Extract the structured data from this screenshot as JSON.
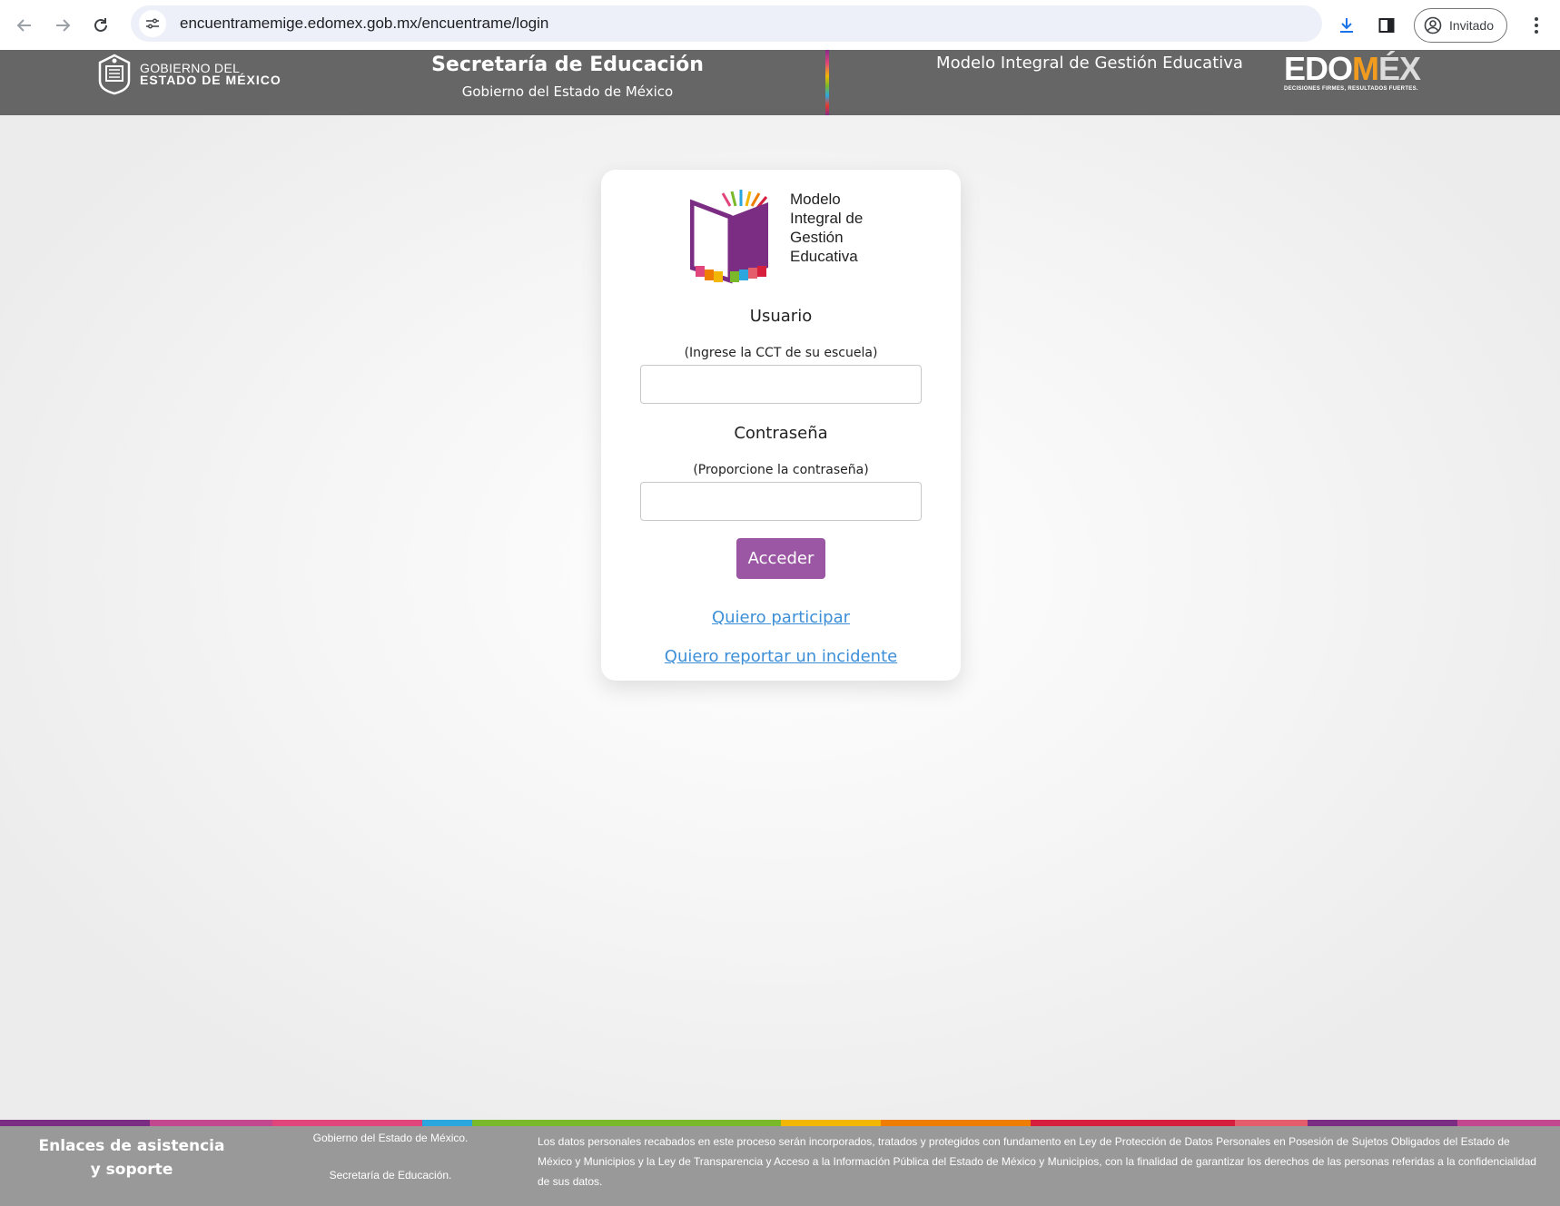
{
  "browser": {
    "url": "encuentramemige.edomex.gob.mx/encuentrame/login",
    "profile_label": "Invitado"
  },
  "header": {
    "gob_logo_line1": "GOBIERNO DEL",
    "gob_logo_line2": "ESTADO DE MÉXICO",
    "title": "Secretaría de Educación",
    "subtitle": "Gobierno del Estado de México",
    "program_title": "Modelo Integral de Gestión Educativa",
    "edomex_logo": {
      "word_edo": "EDO",
      "word_m": "M",
      "word_ex": "ÉX",
      "tagline": "DECISIONES FIRMES, RESULTADOS FUERTES."
    }
  },
  "login": {
    "logo_text": [
      "Modelo",
      "Integral de",
      "Gestión",
      "Educativa"
    ],
    "usuario_label": "Usuario",
    "usuario_hint": "(Ingrese la CCT de su escuela)",
    "usuario_value": "",
    "password_label": "Contraseña",
    "password_hint": "(Proporcione la contraseña)",
    "password_value": "",
    "submit_label": "Acceder",
    "link_participar": "Quiero participar",
    "link_incidente": "Quiero reportar un incidente"
  },
  "footer": {
    "title": "Enlaces de asistencia y soporte",
    "gob": "Gobierno del Estado de México.",
    "secretaria": "Secretaría de Educación.",
    "legal": "Los datos personales recabados en este proceso serán incorporados, tratados y protegidos con fundamento en Ley de Protección de Datos Personales en Posesión de Sujetos Obligados del Estado de México y Municipios y la Ley de Transparencia y Acceso a la Información Pública del Estado de México y Municipios, con la finalidad de garantizar los derechos de las personas referidas a la confidencialidad de sus datos."
  },
  "colors": {
    "header_bg": "#666666",
    "footer_bg": "#999999",
    "button": "#9b57a3",
    "link": "#3d8fd8",
    "stripe": [
      "#7b2c83",
      "#c2478e",
      "#2aa7df",
      "#7ab929",
      "#f2b705",
      "#ef7d00",
      "#d61f3c",
      "#e35d6a",
      "#7b2c83",
      "#c2478e"
    ]
  }
}
